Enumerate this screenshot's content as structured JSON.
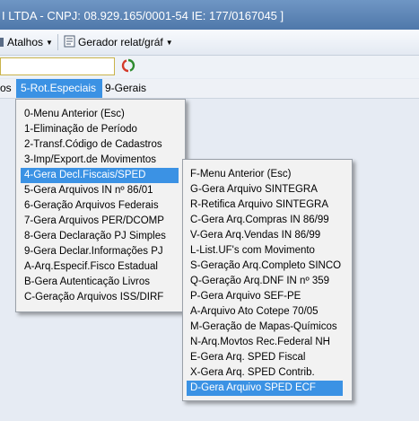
{
  "window": {
    "title": "I LTDA - CNPJ: 08.929.165/0001-54 IE: 177/0167045 ]"
  },
  "toolbar": {
    "atalhos": "Atalhos",
    "gerador": "Gerador relat/gráf"
  },
  "menubar": {
    "items": [
      "os",
      "5-Rot.Especiais",
      "9-Gerais"
    ]
  },
  "menu1": {
    "items": [
      "0-Menu Anterior (Esc)",
      "1-Eliminação de Período",
      "2-Transf.Código de Cadastros",
      "3-Imp/Export.de Movimentos",
      "4-Gera Decl.Fiscais/SPED",
      "5-Gera Arquivos IN nº 86/01",
      "6-Geração Arquivos Federais",
      "7-Gera Arquivos PER/DCOMP",
      "8-Gera Declaração PJ Simples",
      "9-Gera Declar.Informações PJ",
      "A-Arq.Especif.Fisco Estadual",
      "B-Gera Autenticação Livros",
      "C-Geração Arquivos ISS/DIRF"
    ]
  },
  "menu2": {
    "items": [
      "F-Menu Anterior (Esc)",
      "G-Gera Arquivo SINTEGRA",
      "R-Retifica Arquivo SINTEGRA",
      "C-Gera Arq.Compras IN 86/99",
      "V-Gera Arq.Vendas IN 86/99",
      "L-List.UF's com Movimento",
      "S-Geração Arq.Completo SINCO",
      "Q-Geração Arq.DNF IN nº 359",
      "P-Gera Arquivo SEF-PE",
      "A-Arquivo Ato Cotepe 70/05",
      "M-Geração de Mapas-Químicos",
      "N-Arq.Movtos Rec.Federal NH",
      "E-Gera Arq. SPED Fiscal",
      "X-Gera Arq. SPED Contrib.",
      "D-Gera Arquivo SPED ECF"
    ]
  }
}
